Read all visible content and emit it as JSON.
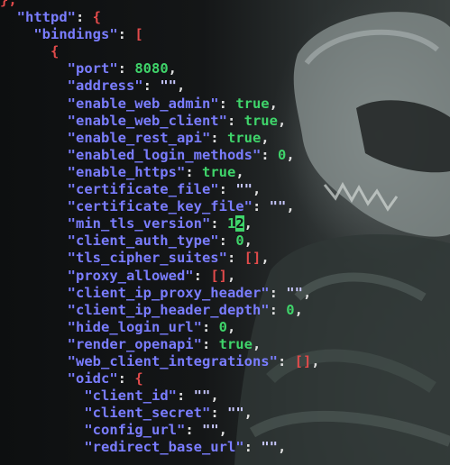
{
  "colors": {
    "key": "#7a7dff",
    "brace": "#e24b4b",
    "number": "#3fd46a",
    "boolean": "#3fd46a",
    "string": "#c8c8ff",
    "cursor": "#3fd46a"
  },
  "lines": [
    {
      "indent": "",
      "parts": [
        {
          "t": "punct",
          "v": "},"
        }
      ]
    },
    {
      "indent": "  ",
      "parts": [
        {
          "t": "key",
          "v": "\"httpd\""
        },
        {
          "t": "colon",
          "v": ": "
        },
        {
          "t": "punct",
          "v": "{"
        }
      ]
    },
    {
      "indent": "    ",
      "parts": [
        {
          "t": "key",
          "v": "\"bindings\""
        },
        {
          "t": "colon",
          "v": ": "
        },
        {
          "t": "punct",
          "v": "["
        }
      ]
    },
    {
      "indent": "      ",
      "parts": [
        {
          "t": "punct",
          "v": "{"
        }
      ]
    },
    {
      "indent": "        ",
      "parts": [
        {
          "t": "key",
          "v": "\"port\""
        },
        {
          "t": "colon",
          "v": ": "
        },
        {
          "t": "num",
          "v": "8080"
        },
        {
          "t": "comma",
          "v": ","
        }
      ]
    },
    {
      "indent": "        ",
      "parts": [
        {
          "t": "key",
          "v": "\"address\""
        },
        {
          "t": "colon",
          "v": ": "
        },
        {
          "t": "str",
          "v": "\"\""
        },
        {
          "t": "comma",
          "v": ","
        }
      ]
    },
    {
      "indent": "        ",
      "parts": [
        {
          "t": "key",
          "v": "\"enable_web_admin\""
        },
        {
          "t": "colon",
          "v": ": "
        },
        {
          "t": "bool",
          "v": "true"
        },
        {
          "t": "comma",
          "v": ","
        }
      ]
    },
    {
      "indent": "        ",
      "parts": [
        {
          "t": "key",
          "v": "\"enable_web_client\""
        },
        {
          "t": "colon",
          "v": ": "
        },
        {
          "t": "bool",
          "v": "true"
        },
        {
          "t": "comma",
          "v": ","
        }
      ]
    },
    {
      "indent": "        ",
      "parts": [
        {
          "t": "key",
          "v": "\"enable_rest_api\""
        },
        {
          "t": "colon",
          "v": ": "
        },
        {
          "t": "bool",
          "v": "true"
        },
        {
          "t": "comma",
          "v": ","
        }
      ]
    },
    {
      "indent": "        ",
      "parts": [
        {
          "t": "key",
          "v": "\"enabled_login_methods\""
        },
        {
          "t": "colon",
          "v": ": "
        },
        {
          "t": "num",
          "v": "0"
        },
        {
          "t": "comma",
          "v": ","
        }
      ]
    },
    {
      "indent": "        ",
      "parts": [
        {
          "t": "key",
          "v": "\"enable_https\""
        },
        {
          "t": "colon",
          "v": ": "
        },
        {
          "t": "bool",
          "v": "true"
        },
        {
          "t": "comma",
          "v": ","
        }
      ]
    },
    {
      "indent": "        ",
      "parts": [
        {
          "t": "key",
          "v": "\"certificate_file\""
        },
        {
          "t": "colon",
          "v": ": "
        },
        {
          "t": "str",
          "v": "\"\""
        },
        {
          "t": "comma",
          "v": ","
        }
      ]
    },
    {
      "indent": "        ",
      "parts": [
        {
          "t": "key",
          "v": "\"certificate_key_file\""
        },
        {
          "t": "colon",
          "v": ": "
        },
        {
          "t": "str",
          "v": "\"\""
        },
        {
          "t": "comma",
          "v": ","
        }
      ]
    },
    {
      "indent": "        ",
      "parts": [
        {
          "t": "key",
          "v": "\"min_tls_version\""
        },
        {
          "t": "colon",
          "v": ": "
        },
        {
          "t": "num",
          "v": "1"
        },
        {
          "t": "cursor",
          "v": "2"
        },
        {
          "t": "comma",
          "v": ","
        }
      ]
    },
    {
      "indent": "        ",
      "parts": [
        {
          "t": "key",
          "v": "\"client_auth_type\""
        },
        {
          "t": "colon",
          "v": ": "
        },
        {
          "t": "num",
          "v": "0"
        },
        {
          "t": "comma",
          "v": ","
        }
      ]
    },
    {
      "indent": "        ",
      "parts": [
        {
          "t": "key",
          "v": "\"tls_cipher_suites\""
        },
        {
          "t": "colon",
          "v": ": "
        },
        {
          "t": "punct",
          "v": "[]"
        },
        {
          "t": "comma",
          "v": ","
        }
      ]
    },
    {
      "indent": "        ",
      "parts": [
        {
          "t": "key",
          "v": "\"proxy_allowed\""
        },
        {
          "t": "colon",
          "v": ": "
        },
        {
          "t": "punct",
          "v": "[]"
        },
        {
          "t": "comma",
          "v": ","
        }
      ]
    },
    {
      "indent": "        ",
      "parts": [
        {
          "t": "key",
          "v": "\"client_ip_proxy_header\""
        },
        {
          "t": "colon",
          "v": ": "
        },
        {
          "t": "str",
          "v": "\"\""
        },
        {
          "t": "comma",
          "v": ","
        }
      ]
    },
    {
      "indent": "        ",
      "parts": [
        {
          "t": "key",
          "v": "\"client_ip_header_depth\""
        },
        {
          "t": "colon",
          "v": ": "
        },
        {
          "t": "num",
          "v": "0"
        },
        {
          "t": "comma",
          "v": ","
        }
      ]
    },
    {
      "indent": "        ",
      "parts": [
        {
          "t": "key",
          "v": "\"hide_login_url\""
        },
        {
          "t": "colon",
          "v": ": "
        },
        {
          "t": "num",
          "v": "0"
        },
        {
          "t": "comma",
          "v": ","
        }
      ]
    },
    {
      "indent": "        ",
      "parts": [
        {
          "t": "key",
          "v": "\"render_openapi\""
        },
        {
          "t": "colon",
          "v": ": "
        },
        {
          "t": "bool",
          "v": "true"
        },
        {
          "t": "comma",
          "v": ","
        }
      ]
    },
    {
      "indent": "        ",
      "parts": [
        {
          "t": "key",
          "v": "\"web_client_integrations\""
        },
        {
          "t": "colon",
          "v": ": "
        },
        {
          "t": "punct",
          "v": "[]"
        },
        {
          "t": "comma",
          "v": ","
        }
      ]
    },
    {
      "indent": "        ",
      "parts": [
        {
          "t": "key",
          "v": "\"oidc\""
        },
        {
          "t": "colon",
          "v": ": "
        },
        {
          "t": "punct",
          "v": "{"
        }
      ]
    },
    {
      "indent": "          ",
      "parts": [
        {
          "t": "key",
          "v": "\"client_id\""
        },
        {
          "t": "colon",
          "v": ": "
        },
        {
          "t": "str",
          "v": "\"\""
        },
        {
          "t": "comma",
          "v": ","
        }
      ]
    },
    {
      "indent": "          ",
      "parts": [
        {
          "t": "key",
          "v": "\"client_secret\""
        },
        {
          "t": "colon",
          "v": ": "
        },
        {
          "t": "str",
          "v": "\"\""
        },
        {
          "t": "comma",
          "v": ","
        }
      ]
    },
    {
      "indent": "          ",
      "parts": [
        {
          "t": "key",
          "v": "\"config_url\""
        },
        {
          "t": "colon",
          "v": ": "
        },
        {
          "t": "str",
          "v": "\"\""
        },
        {
          "t": "comma",
          "v": ","
        }
      ]
    },
    {
      "indent": "          ",
      "parts": [
        {
          "t": "key",
          "v": "\"redirect_base_url\""
        },
        {
          "t": "colon",
          "v": ": "
        },
        {
          "t": "str",
          "v": "\"\""
        },
        {
          "t": "comma",
          "v": ","
        }
      ]
    }
  ]
}
